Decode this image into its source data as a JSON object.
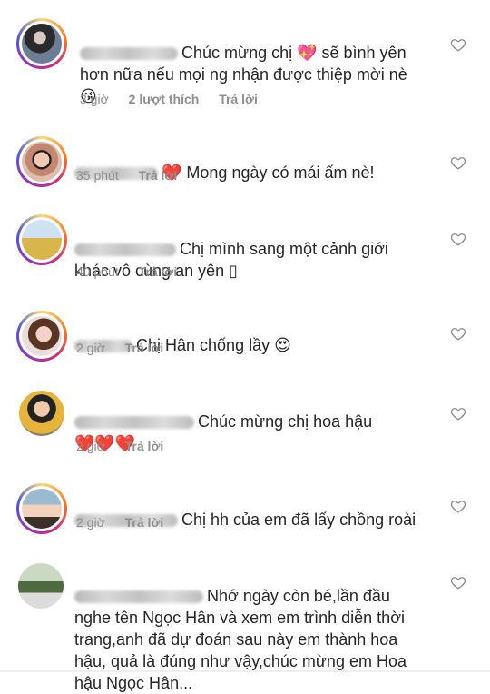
{
  "comments": [
    {
      "text": "Chúc mừng chị 💖 sẽ bình yên\nhơn nữa nếu mọi ng nhận được thiệp mời nè\n😘",
      "time": "3 giờ",
      "likes": "2 lượt thích",
      "reply": "Trả lời"
    },
    {
      "text": "❤️ Mong ngày có mái ấm nè!",
      "time": "35 phút",
      "reply": "Trả lời"
    },
    {
      "text": "Chị mình sang một cảnh giới\nkhác vô cùng an yên ▯",
      "time": "40 phút",
      "reply": "Trả lời"
    },
    {
      "text": "Chị Hân chống lầy 😍",
      "time": "2 giờ",
      "reply": "Trả lời"
    },
    {
      "text": "Chúc mừng chị hoa hậu\n❤️❤️❤️",
      "time": "2 giờ",
      "reply": "Trả lời"
    },
    {
      "text": "Chị hh của em đã lấy chồng roài",
      "time": "2 giờ",
      "reply": "Trả lời"
    },
    {
      "text": "Nhớ ngày còn bé,lần đầu\nnghe tên Ngọc Hân và xem em trình diễn thời\ntrang,anh đã dự đoán sau này em thành hoa\nhậu, quả là đúng như vậy,chúc mừng em Hoa\nhậu Ngọc Hân..."
    }
  ],
  "icons": {
    "like": "heart-outline-icon"
  },
  "colors": {
    "text": "#262626",
    "meta": "#8e8e8e",
    "heart_red": "#ed4956"
  }
}
